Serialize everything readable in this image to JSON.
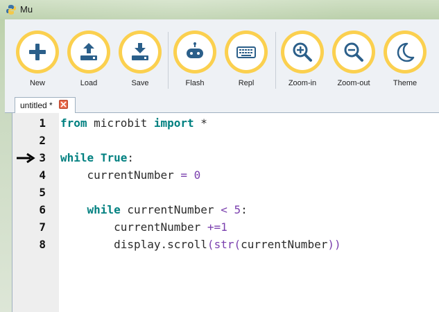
{
  "window": {
    "title": "Mu"
  },
  "toolbar": {
    "buttons": [
      {
        "label": "New",
        "icon": "plus-icon"
      },
      {
        "label": "Load",
        "icon": "upload-icon"
      },
      {
        "label": "Save",
        "icon": "download-icon"
      },
      {
        "label": "Flash",
        "icon": "microbit-icon"
      },
      {
        "label": "Repl",
        "icon": "keyboard-icon"
      },
      {
        "label": "Zoom-in",
        "icon": "zoom-in-icon"
      },
      {
        "label": "Zoom-out",
        "icon": "zoom-out-icon"
      },
      {
        "label": "Theme",
        "icon": "moon-icon"
      }
    ]
  },
  "tabs": [
    {
      "label": "untitled *"
    }
  ],
  "editor": {
    "lines": [
      {
        "num": "1"
      },
      {
        "num": "2"
      },
      {
        "num": "3"
      },
      {
        "num": "4"
      },
      {
        "num": "5"
      },
      {
        "num": "6"
      },
      {
        "num": "7"
      },
      {
        "num": "8"
      }
    ],
    "tokens": {
      "l1_from": "from",
      "l1_mod": " microbit ",
      "l1_import": "import",
      "l1_star": " *",
      "l3_while": "while",
      "l3_true": "True",
      "l3_colon": ":",
      "l4_var": "    currentNumber ",
      "l4_eq": "=",
      "l4_zero": " 0",
      "l6_while": "    while",
      "l6_var": " currentNumber ",
      "l6_lt": "<",
      "l6_num": " 5",
      "l6_colon": ":",
      "l7_var": "        currentNumber ",
      "l7_op": "+=",
      "l7_num": "1",
      "l8_call": "        display.scroll",
      "l8_p1": "(",
      "l8_str": "str",
      "l8_p2": "(",
      "l8_var": "currentNumber",
      "l8_p3": "))"
    }
  },
  "colors": {
    "accent_ring": "#fbd04f",
    "icon": "#2b5f8a",
    "keyword": "#008080",
    "operator": "#7a3fae"
  }
}
